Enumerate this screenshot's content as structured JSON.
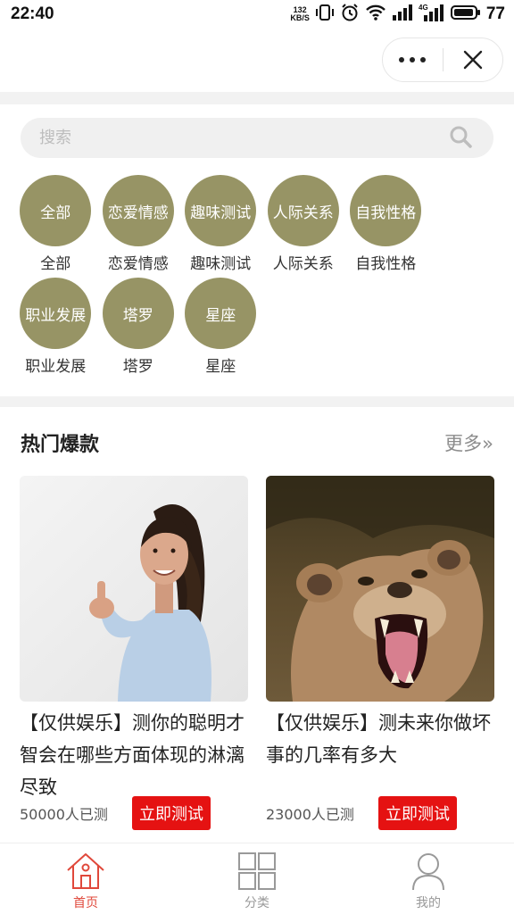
{
  "status_bar": {
    "time": "22:40",
    "net_speed_value": "132",
    "net_speed_unit": "KB/S",
    "network_type": "4G",
    "battery": "77"
  },
  "search": {
    "placeholder": "搜索"
  },
  "categories": [
    {
      "circle": "全部",
      "label": "全部"
    },
    {
      "circle": "恋爱情感",
      "label": "恋爱情感"
    },
    {
      "circle": "趣味测试",
      "label": "趣味测试"
    },
    {
      "circle": "人际关系",
      "label": "人际关系"
    },
    {
      "circle": "自我性格",
      "label": "自我性格"
    },
    {
      "circle": "职业发展",
      "label": "职业发展"
    },
    {
      "circle": "塔罗",
      "label": "塔罗"
    },
    {
      "circle": "星座",
      "label": "星座"
    }
  ],
  "hot": {
    "title": "热门爆款",
    "more": "更多»",
    "items": [
      {
        "title": "【仅供娱乐】测你的聪明才智会在哪些方面体现的淋漓尽致",
        "count": "50000人已测",
        "button": "立即测试"
      },
      {
        "title": "【仅供娱乐】测未来你做坏事的几率有多大",
        "count": "23000人已测",
        "button": "立即测试"
      }
    ]
  },
  "tabbar": {
    "items": [
      {
        "label": "首页"
      },
      {
        "label": "分类"
      },
      {
        "label": "我的"
      }
    ]
  },
  "colors": {
    "category_circle": "#979465",
    "accent_red": "#e51212",
    "active_tab": "#e0483b"
  }
}
